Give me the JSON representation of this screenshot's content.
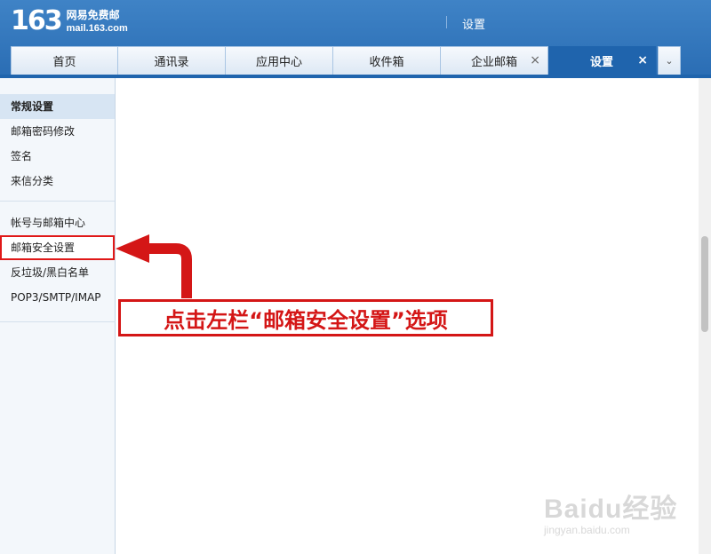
{
  "header": {
    "logo_number": "163",
    "logo_cn": "网易免费邮",
    "logo_en": "mail.163.com",
    "title": "设置"
  },
  "tabs": [
    {
      "label": "首页",
      "closable": false,
      "active": false
    },
    {
      "label": "通讯录",
      "closable": false,
      "active": false
    },
    {
      "label": "应用中心",
      "closable": false,
      "active": false
    },
    {
      "label": "收件箱",
      "closable": false,
      "active": false
    },
    {
      "label": "企业邮箱",
      "closable": true,
      "active": false
    },
    {
      "label": "设置",
      "closable": true,
      "active": true
    }
  ],
  "tab_close_glyph": "×",
  "tab_more_glyph": "⌄",
  "sidebar": {
    "group1": [
      "常规设置",
      "邮箱密码修改",
      "签名",
      "来信分类"
    ],
    "group2": [
      "帐号与邮箱中心",
      "邮箱安全设置",
      "反垃圾/黑白名单",
      "POP3/SMTP/IMAP"
    ]
  },
  "annotation": {
    "text": "点击左栏“邮箱安全设置”选项"
  },
  "watermark": {
    "main": "Baidu经验",
    "sub": "jingyan.baidu.com"
  },
  "colors": {
    "header_blue": "#2a6db4",
    "active_tab": "#1f64ad",
    "annotation_red": "#d41616"
  }
}
